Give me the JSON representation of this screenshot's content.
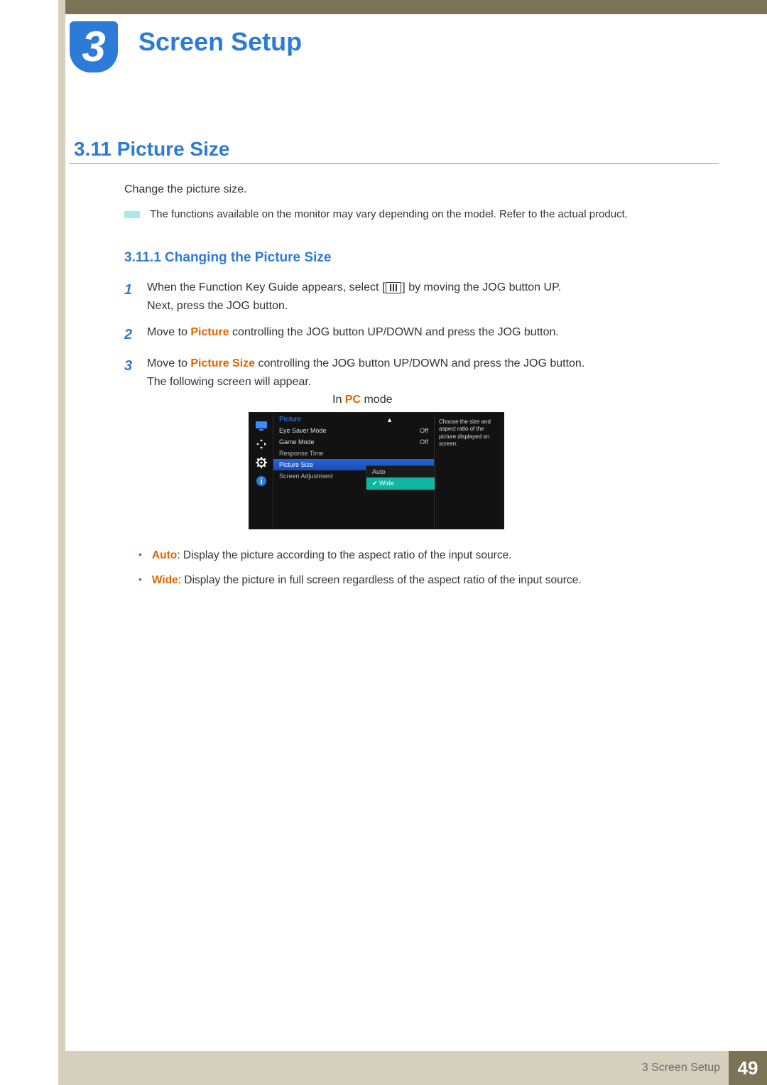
{
  "chapter": {
    "number": "3",
    "title": "Screen Setup"
  },
  "section": {
    "number": "3.11",
    "title": "Picture Size",
    "heading": "3.11  Picture Size"
  },
  "intro": "Change the picture size.",
  "note": "The functions available on the monitor may vary depending on the model. Refer to the actual product.",
  "subsection": {
    "number": "3.11.1",
    "title": "Changing the Picture Size",
    "heading": "3.11.1  Changing the Picture Size"
  },
  "steps": {
    "s1": {
      "num": "1",
      "pre": "When the Function Key Guide appears, select [",
      "post": "] by moving the JOG button UP.",
      "line2": "Next, press the JOG button."
    },
    "s2": {
      "num": "2",
      "pre": "Move to ",
      "key": "Picture",
      "post": " controlling the JOG button UP/DOWN and press the JOG button."
    },
    "s3": {
      "num": "3",
      "pre": "Move to ",
      "key": "Picture Size",
      "post": " controlling the JOG button UP/DOWN and press the JOG button.",
      "line2": "The following screen will appear."
    }
  },
  "mode": {
    "pre": "In ",
    "key": "PC",
    "post": " mode"
  },
  "osd": {
    "header": "Picture",
    "items": {
      "eye": {
        "label": "Eye Saver Mode",
        "value": "Off"
      },
      "game": {
        "label": "Game Mode",
        "value": "Off"
      },
      "response": {
        "label": "Response Time",
        "value": ""
      },
      "picsize": {
        "label": "Picture Size",
        "value": ""
      },
      "screenadj": {
        "label": "Screen Adjustment",
        "value": ""
      }
    },
    "popup": {
      "auto": "Auto",
      "wide": "Wide"
    },
    "help": "Choose the size and aspect ratio of the picture displayed on screen."
  },
  "bullets": {
    "auto": {
      "key": "Auto",
      "text": ": Display the picture according to the aspect ratio of the input source."
    },
    "wide": {
      "key": "Wide",
      "text": ": Display the picture in full screen regardless of the aspect ratio of the input source."
    }
  },
  "footer": {
    "chapter": "3 Screen Setup",
    "page": "49"
  }
}
